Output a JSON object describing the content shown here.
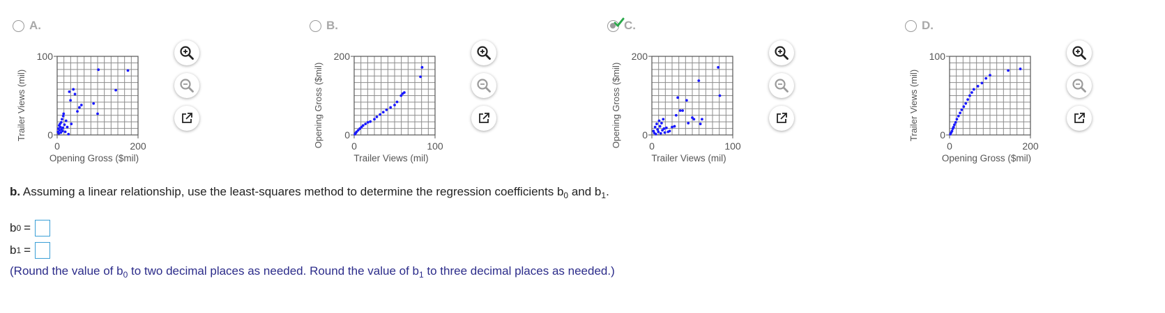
{
  "colors": {
    "point": "#1a1aff",
    "grid": "#8c8c8c",
    "axis_text": "#555555",
    "hint": "#2c2c8a",
    "input_border": "#3a9fd6",
    "check": "#2aa84a"
  },
  "icons": {
    "zoom_in": "zoom-in-icon",
    "zoom_out": "zoom-out-icon",
    "open_new": "open-in-new-window-icon"
  },
  "options": [
    {
      "letter": "A.",
      "selected": false
    },
    {
      "letter": "B.",
      "selected": false
    },
    {
      "letter": "C.",
      "selected": true
    },
    {
      "letter": "D.",
      "selected": false
    }
  ],
  "chart_data": [
    {
      "type": "scatter",
      "xlabel": "Opening Gross ($mil)",
      "ylabel": "Trailer Views (mil)",
      "xlim": [
        0,
        200
      ],
      "ylim": [
        0,
        100
      ],
      "x_ticks": [
        "0",
        "200"
      ],
      "y_ticks": [
        "0",
        "100"
      ],
      "grid": true,
      "points": [
        [
          2,
          4
        ],
        [
          3,
          8
        ],
        [
          4,
          2
        ],
        [
          5,
          12
        ],
        [
          6,
          6
        ],
        [
          7,
          14
        ],
        [
          8,
          10
        ],
        [
          9,
          3
        ],
        [
          10,
          16
        ],
        [
          11,
          7
        ],
        [
          12,
          20
        ],
        [
          13,
          5
        ],
        [
          14,
          9
        ],
        [
          15,
          24
        ],
        [
          16,
          27
        ],
        [
          18,
          13
        ],
        [
          20,
          4
        ],
        [
          22,
          18
        ],
        [
          25,
          10
        ],
        [
          28,
          1
        ],
        [
          30,
          55
        ],
        [
          33,
          44
        ],
        [
          35,
          14
        ],
        [
          40,
          58
        ],
        [
          44,
          52
        ],
        [
          50,
          30
        ],
        [
          55,
          35
        ],
        [
          60,
          38
        ],
        [
          90,
          40
        ],
        [
          100,
          27
        ],
        [
          102,
          83
        ],
        [
          145,
          57
        ],
        [
          175,
          82
        ]
      ]
    },
    {
      "type": "scatter",
      "xlabel": "Trailer Views (mil)",
      "ylabel": "Opening Gross ($mil)",
      "xlim": [
        0,
        100
      ],
      "ylim": [
        0,
        200
      ],
      "x_ticks": [
        "0",
        "100"
      ],
      "y_ticks": [
        "0",
        "200"
      ],
      "grid": true,
      "points": [
        [
          1,
          2
        ],
        [
          2,
          5
        ],
        [
          3,
          8
        ],
        [
          5,
          12
        ],
        [
          7,
          16
        ],
        [
          9,
          20
        ],
        [
          11,
          24
        ],
        [
          14,
          28
        ],
        [
          17,
          32
        ],
        [
          20,
          34
        ],
        [
          25,
          40
        ],
        [
          28,
          46
        ],
        [
          32,
          52
        ],
        [
          36,
          58
        ],
        [
          40,
          64
        ],
        [
          45,
          70
        ],
        [
          50,
          76
        ],
        [
          53,
          84
        ],
        [
          58,
          100
        ],
        [
          60,
          105
        ],
        [
          62,
          108
        ],
        [
          82,
          148
        ],
        [
          84,
          172
        ]
      ]
    },
    {
      "type": "scatter",
      "xlabel": "Trailer Views (mil)",
      "ylabel": "Opening Gross ($mil)",
      "xlim": [
        0,
        100
      ],
      "ylim": [
        0,
        200
      ],
      "x_ticks": [
        "0",
        "100"
      ],
      "y_ticks": [
        "0",
        "200"
      ],
      "grid": true,
      "points": [
        [
          2,
          10
        ],
        [
          3,
          5
        ],
        [
          4,
          20
        ],
        [
          5,
          2
        ],
        [
          6,
          28
        ],
        [
          7,
          14
        ],
        [
          8,
          8
        ],
        [
          9,
          36
        ],
        [
          10,
          22
        ],
        [
          11,
          4
        ],
        [
          12,
          30
        ],
        [
          13,
          12
        ],
        [
          14,
          40
        ],
        [
          15,
          16
        ],
        [
          16,
          6
        ],
        [
          18,
          18
        ],
        [
          20,
          8
        ],
        [
          22,
          10
        ],
        [
          25,
          20
        ],
        [
          28,
          22
        ],
        [
          30,
          50
        ],
        [
          32,
          95
        ],
        [
          35,
          62
        ],
        [
          38,
          62
        ],
        [
          43,
          88
        ],
        [
          45,
          30
        ],
        [
          50,
          44
        ],
        [
          52,
          40
        ],
        [
          58,
          138
        ],
        [
          60,
          28
        ],
        [
          62,
          40
        ],
        [
          82,
          172
        ],
        [
          84,
          100
        ]
      ]
    },
    {
      "type": "scatter",
      "xlabel": "Opening Gross ($mil)",
      "ylabel": "Trailer Views (mil)",
      "xlim": [
        0,
        200
      ],
      "ylim": [
        0,
        100
      ],
      "x_ticks": [
        "0",
        "200"
      ],
      "y_ticks": [
        "0",
        "100"
      ],
      "grid": true,
      "points": [
        [
          2,
          1
        ],
        [
          4,
          3
        ],
        [
          6,
          5
        ],
        [
          8,
          8
        ],
        [
          10,
          10
        ],
        [
          12,
          13
        ],
        [
          15,
          16
        ],
        [
          18,
          20
        ],
        [
          22,
          24
        ],
        [
          26,
          28
        ],
        [
          30,
          32
        ],
        [
          35,
          36
        ],
        [
          40,
          40
        ],
        [
          45,
          45
        ],
        [
          50,
          50
        ],
        [
          55,
          54
        ],
        [
          60,
          58
        ],
        [
          70,
          62
        ],
        [
          80,
          66
        ],
        [
          90,
          72
        ],
        [
          100,
          76
        ],
        [
          145,
          82
        ],
        [
          175,
          84
        ]
      ]
    }
  ],
  "question": {
    "part": "b.",
    "text_before": "Assuming a linear relationship, use the least-squares method to determine the regression coefficients b",
    "sub_b0": "0",
    "text_and": "and b",
    "sub_b1": "1",
    "text_end": "."
  },
  "answers": [
    {
      "label": "b",
      "sub": "0",
      "eq": "=",
      "value": ""
    },
    {
      "label": "b",
      "sub": "1",
      "eq": "=",
      "value": ""
    }
  ],
  "hint": {
    "p1": "(Round the value of b",
    "s1": "0",
    "p2": "to two decimal places as needed. Round the value of b",
    "s2": "1",
    "p3": "to three decimal places as needed.)"
  }
}
